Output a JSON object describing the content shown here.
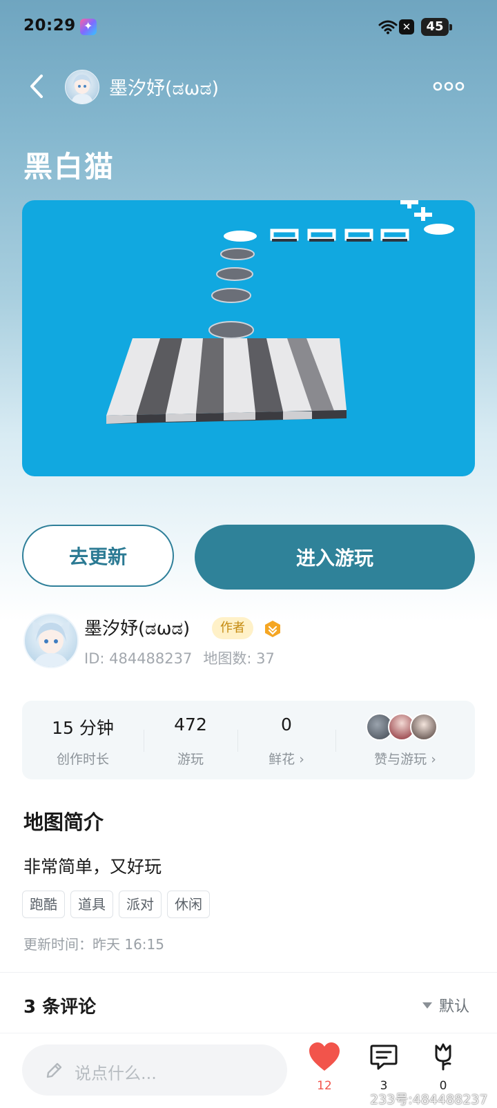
{
  "status_bar": {
    "time": "20:29",
    "battery": "45"
  },
  "header": {
    "author_name": "墨汐妤(ಡωಡ)"
  },
  "map": {
    "title": "黑白猫"
  },
  "actions": {
    "update_label": "去更新",
    "play_label": "进入游玩"
  },
  "author": {
    "name": "墨汐妤(ಡωಡ)",
    "tag": "作者",
    "id_text": "ID: 484488237",
    "map_count_text": "地图数: 37"
  },
  "stats": {
    "duration": {
      "value": "15 分钟",
      "label": "创作时长"
    },
    "plays": {
      "value": "472",
      "label": "游玩"
    },
    "flowers": {
      "value": "0",
      "label": "鲜花 ›"
    },
    "likes": {
      "label": "赞与游玩 ›"
    }
  },
  "intro": {
    "title": "地图简介",
    "description": "非常简单，又好玩",
    "tags": [
      "跑酷",
      "道具",
      "派对",
      "休闲"
    ],
    "update_time": "更新时间：昨天 16:15"
  },
  "comments": {
    "title": "3 条评论",
    "sort": "默认"
  },
  "bottom_bar": {
    "placeholder": "说点什么...",
    "like_count": "12",
    "comment_count": "3",
    "flower_count": "0"
  },
  "watermark": "233号:484488237",
  "colors": {
    "accent": "#2f8299",
    "like": "#f2544b",
    "preview_bg": "#11a8e0"
  }
}
